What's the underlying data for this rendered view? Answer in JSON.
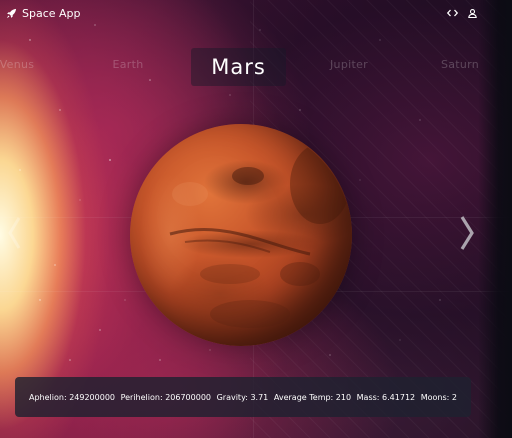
{
  "app": {
    "name": "Space App"
  },
  "header": {
    "icons": [
      {
        "name": "code-icon"
      },
      {
        "name": "user-icon"
      }
    ]
  },
  "planets": {
    "tabs": [
      "Venus",
      "Earth",
      "Mars",
      "Jupiter",
      "Saturn"
    ],
    "selected": "Mars"
  },
  "stats": {
    "aphelion": "Aphelion: 249200000",
    "perihelion": "Perihelion: 206700000",
    "gravity": "Gravity: 3.71",
    "average_temp": "Average Temp: 210",
    "mass": "Mass: 6.41712",
    "moons": "Moons: 2"
  },
  "colors": {
    "background": "#3a1230",
    "planet": "#c9572b",
    "info_bar": "#1e2130",
    "text": "#ffffff",
    "inactive_tab": "#5a4a5a"
  }
}
